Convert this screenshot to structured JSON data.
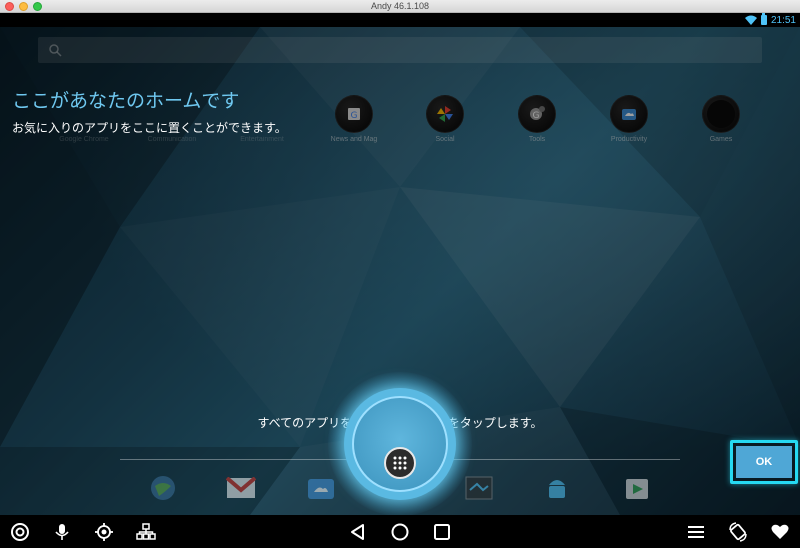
{
  "window": {
    "title": "Andy 46.1.108"
  },
  "status_bar": {
    "time": "21:51",
    "wifi_icon": "wifi-icon",
    "battery_icon": "battery-icon"
  },
  "search": {
    "icon": "google-search-icon"
  },
  "folders": [
    {
      "label": "Google Chrome",
      "faded": true
    },
    {
      "label": "Communication",
      "faded": true
    },
    {
      "label": "Entertainment",
      "faded": true
    },
    {
      "label": "News and Mag",
      "icon": "news-icon"
    },
    {
      "label": "Social",
      "icon": "pinwheel-icon"
    },
    {
      "label": "Tools",
      "icon": "tools-icon"
    },
    {
      "label": "Productivity",
      "icon": "productivity-icon"
    },
    {
      "label": "Games",
      "icon": "games-icon"
    }
  ],
  "onboarding": {
    "heading": "ここがあなたのホームです",
    "subtext": "お気に入りのアプリをここに置くことができます。",
    "hint": "すべてのアプリを見るにはサークルをタップします。",
    "ok_label": "OK"
  },
  "dock": {
    "apps": [
      "browser-icon",
      "gmail-icon",
      "file-manager-icon",
      "all-apps-icon",
      "photo-icon",
      "android-icon",
      "play-store-icon"
    ]
  },
  "colors": {
    "accent": "#6fc8f0",
    "ok_button": "#4fa7d6",
    "ok_highlight": "#26d9f2",
    "status_time": "#4fc3f7"
  },
  "bottom_bar": {
    "left": [
      "target-icon",
      "microphone-icon",
      "location-icon",
      "tree-icon"
    ],
    "center": [
      "back-icon",
      "home-icon",
      "recents-icon"
    ],
    "right": [
      "menu-icon",
      "rotate-icon",
      "heart-icon"
    ]
  }
}
